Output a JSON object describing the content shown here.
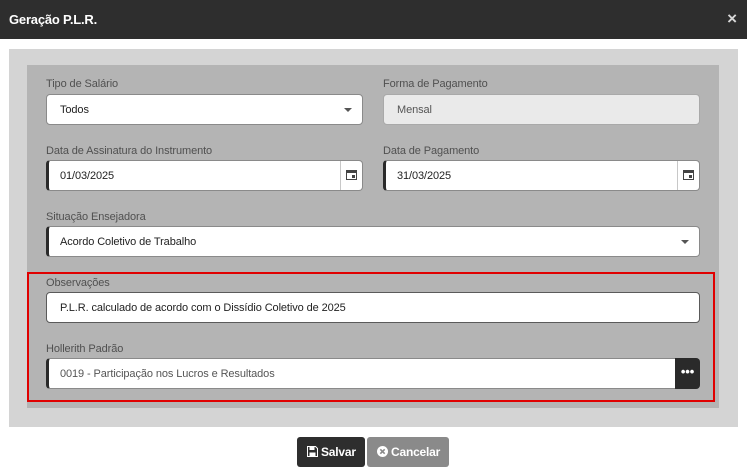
{
  "dialog": {
    "title": "Geração P.L.R.",
    "close": "×"
  },
  "form": {
    "tipo_salario": {
      "label": "Tipo de Salário",
      "value": "Todos"
    },
    "forma_pagamento": {
      "label": "Forma de Pagamento",
      "value": "Mensal"
    },
    "data_assinatura": {
      "label": "Data de Assinatura do Instrumento",
      "value": "01/03/2025"
    },
    "data_pagamento": {
      "label": "Data de Pagamento",
      "value": "31/03/2025"
    },
    "situacao": {
      "label": "Situação Ensejadora",
      "value": "Acordo Coletivo de Trabalho"
    },
    "observacoes": {
      "label": "Observações",
      "value": "P.L.R. calculado de acordo com o Dissídio Coletivo de 2025"
    },
    "hollerith": {
      "label": "Hollerith Padrão",
      "value": "0019 - Participação nos Lucros e Resultados",
      "lookup": "•••"
    }
  },
  "buttons": {
    "save": "Salvar",
    "cancel": "Cancelar"
  },
  "colors": {
    "highlight": "#e00000",
    "title_bar": "#2e2e2e"
  }
}
